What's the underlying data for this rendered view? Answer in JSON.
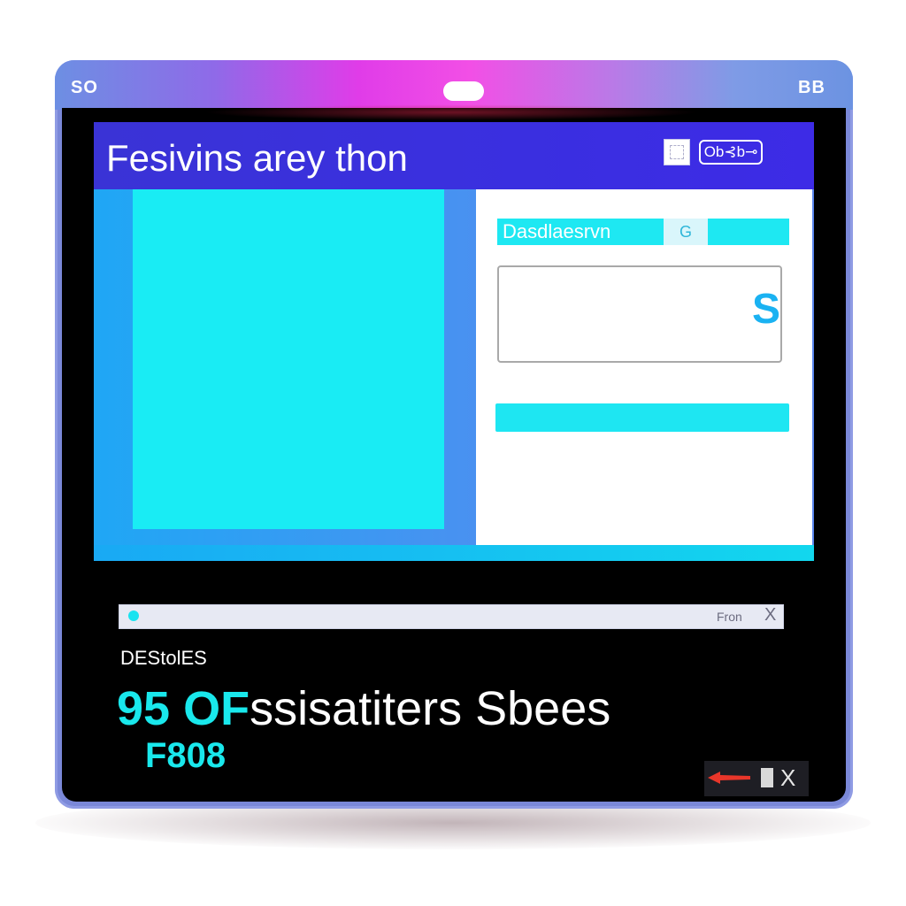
{
  "window": {
    "left_label": "SO",
    "right_label": "BB"
  },
  "app": {
    "title": "Fesivins arey thon",
    "header_button": "Ob⊰b⊸"
  },
  "form": {
    "desc_label": "Dasdlaesrvn",
    "desc_chip": "G",
    "input_value": "S"
  },
  "search": {
    "text": "Fron",
    "close": "X"
  },
  "lower": {
    "section_label": "DEStolES",
    "big_number": "95 OF",
    "big_text": "ssisatiters Sbees",
    "sub_text": "F808"
  },
  "tray": {
    "close": "X"
  },
  "colors": {
    "accent_cyan": "#19ecf4",
    "header_blue": "#3a33d6",
    "magenta": "#e03ce8"
  }
}
